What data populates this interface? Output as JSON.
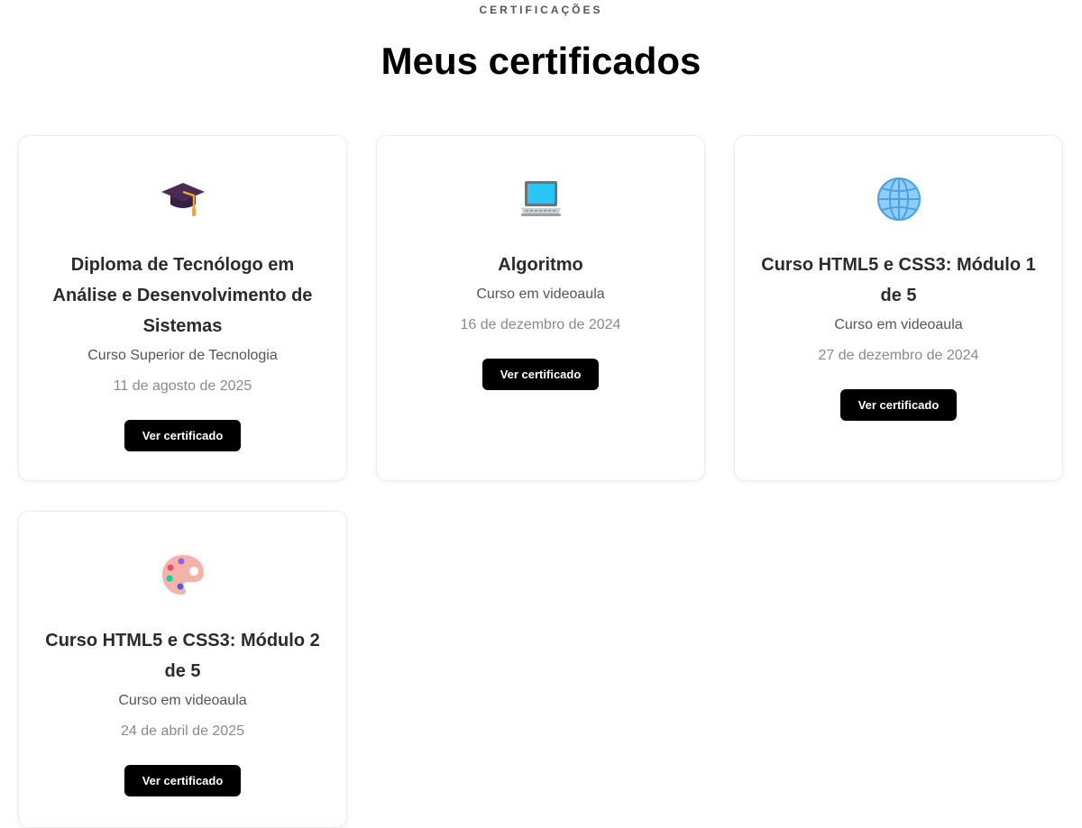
{
  "header": {
    "eyebrow": "CERTIFICAÇÕES",
    "title": "Meus certificados"
  },
  "cards": [
    {
      "icon": "graduation-cap-icon",
      "title": "Diploma de Tecnólogo em Análise e Desenvolvimento de Sistemas",
      "type": "Curso Superior de Tecnologia",
      "date": "11 de agosto de 2025",
      "button": "Ver certificado"
    },
    {
      "icon": "laptop-icon",
      "title": "Algoritmo",
      "type": "Curso em videoaula",
      "date": "16 de dezembro de 2024",
      "button": "Ver certificado"
    },
    {
      "icon": "globe-icon",
      "title": "Curso HTML5 e CSS3: Módulo 1 de 5",
      "type": "Curso em videoaula",
      "date": "27 de dezembro de 2024",
      "button": "Ver certificado"
    },
    {
      "icon": "palette-icon",
      "title": "Curso HTML5 e CSS3: Módulo 2 de 5",
      "type": "Curso em videoaula",
      "date": "24 de abril de 2025",
      "button": "Ver certificado"
    }
  ],
  "colors": {
    "button_bg": "#000000",
    "button_text": "#ffffff",
    "card_border": "#ececec",
    "date_text": "#8a8a8a"
  }
}
